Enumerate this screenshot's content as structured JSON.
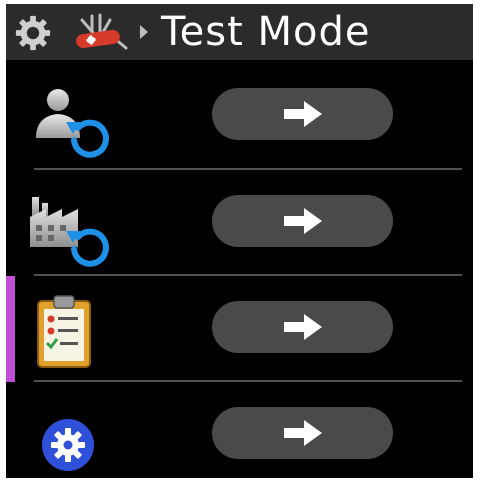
{
  "header": {
    "title": "Test Mode",
    "settings_icon": "gear-icon",
    "tools_icon": "swiss-knife-icon",
    "breadcrumb_icon": "chevron-right-icon"
  },
  "rows": [
    {
      "icon": "user-reset-icon",
      "button_icon": "arrow-right-icon"
    },
    {
      "icon": "factory-reset-icon",
      "button_icon": "arrow-right-icon"
    },
    {
      "icon": "clipboard-checklist-icon",
      "button_icon": "arrow-right-icon",
      "selected": true
    },
    {
      "icon": "settings-gear-icon",
      "button_icon": "arrow-right-icon"
    }
  ],
  "colors": {
    "header_bg": "#2b2b2b",
    "button_bg": "#4a4a4a",
    "selection_accent": "#c14fd6",
    "reset_arrow": "#1e90e8",
    "settings_badge": "#2f50d8"
  }
}
